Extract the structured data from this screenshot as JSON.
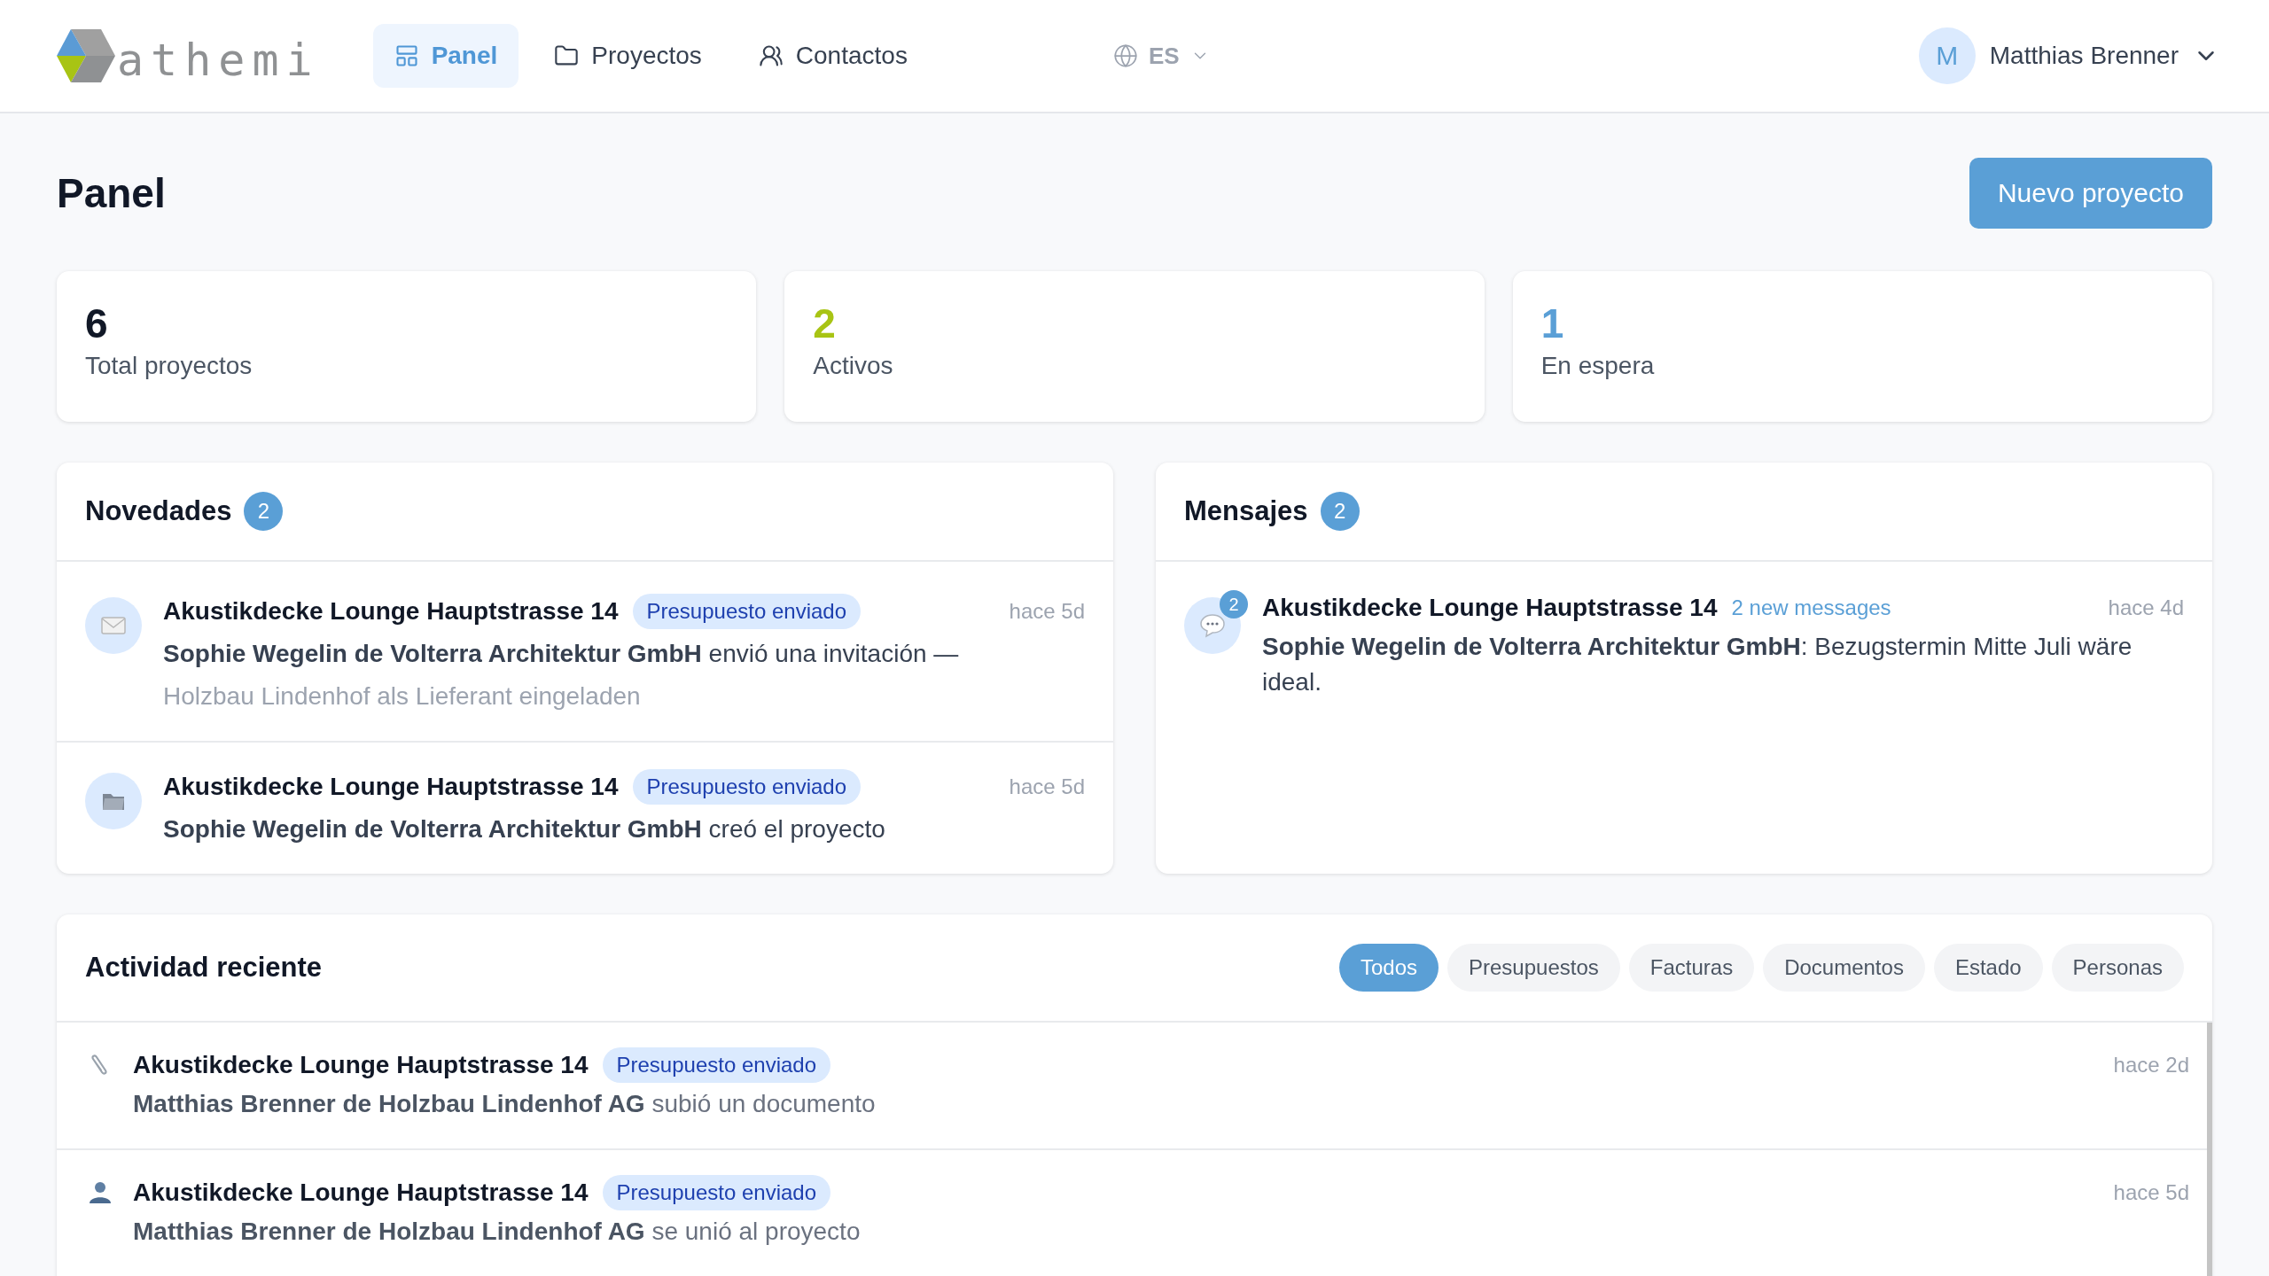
{
  "header": {
    "logo": "athemi",
    "nav": [
      {
        "label": "Panel",
        "selected": true
      },
      {
        "label": "Proyectos",
        "selected": false
      },
      {
        "label": "Contactos",
        "selected": false
      }
    ],
    "language": "ES",
    "user": {
      "initial": "M",
      "name": "Matthias Brenner"
    }
  },
  "page": {
    "title": "Panel",
    "primary_button": "Nuevo proyecto"
  },
  "stats": [
    {
      "value": "6",
      "label": "Total proyectos",
      "color": "#111827"
    },
    {
      "value": "2",
      "label": "Activos",
      "color": "#a8c414"
    },
    {
      "value": "1",
      "label": "En espera",
      "color": "#5a9fd6"
    }
  ],
  "news": {
    "title": "Novedades",
    "count": "2",
    "items": [
      {
        "kind": "mail",
        "project": "Akustikdecke Lounge Hauptstrasse 14",
        "status": "Presupuesto enviado",
        "time": "hace 5d",
        "text": "**Sophie Wegelin de Volterra Architektur GmbH** envió una invitación —",
        "detail": "Holzbau Lindenhof als Lieferant eingeladen"
      },
      {
        "kind": "folder",
        "project": "Akustikdecke Lounge Hauptstrasse 14",
        "status": "Presupuesto enviado",
        "time": "hace 5d",
        "text": "**Sophie Wegelin de Volterra Architektur GmbH** creó el proyecto"
      }
    ]
  },
  "messages": {
    "title": "Mensajes",
    "count": "2",
    "items": [
      {
        "project": "Akustikdecke Lounge Hauptstrasse 14",
        "unread": "2",
        "note": "2 new messages",
        "time": "hace 4d",
        "text": "**Sophie Wegelin de Volterra Architektur GmbH**: Bezugstermin Mitte Juli wäre ideal."
      }
    ]
  },
  "activity": {
    "title": "Actividad reciente",
    "filters": [
      {
        "label": "Todos",
        "selected": true
      },
      {
        "label": "Presupuestos",
        "selected": false
      },
      {
        "label": "Facturas",
        "selected": false
      },
      {
        "label": "Documentos",
        "selected": false
      },
      {
        "label": "Estado",
        "selected": false
      },
      {
        "label": "Personas",
        "selected": false
      }
    ],
    "items": [
      {
        "kind": "attachment",
        "project": "Akustikdecke Lounge Hauptstrasse 14",
        "status": "Presupuesto enviado",
        "time": "hace 2d",
        "text": "**Matthias Brenner de Holzbau Lindenhof AG** subió un documento"
      },
      {
        "kind": "person",
        "project": "Akustikdecke Lounge Hauptstrasse 14",
        "status": "Presupuesto enviado",
        "time": "hace 5d",
        "text": "**Matthias Brenner de Holzbau Lindenhof AG** se unió al proyecto"
      }
    ]
  }
}
